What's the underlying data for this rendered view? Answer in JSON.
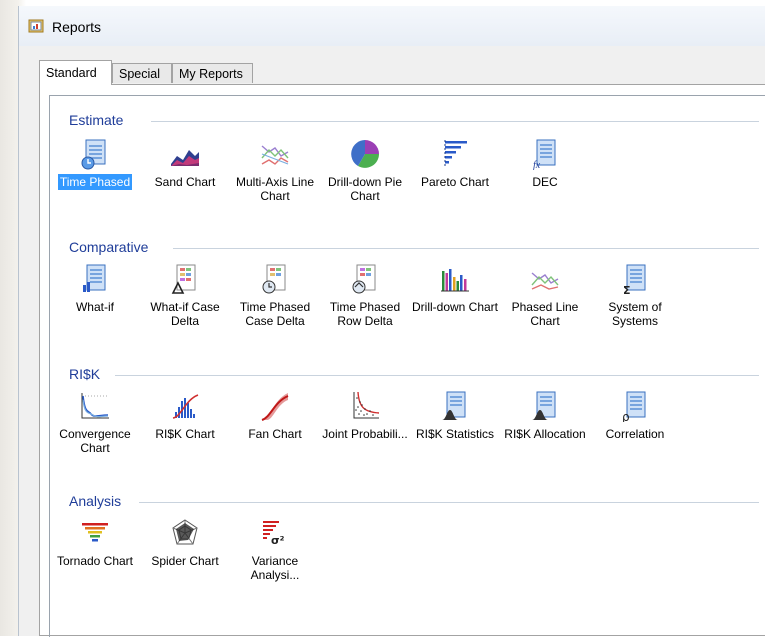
{
  "window": {
    "title": "Reports"
  },
  "tabs": [
    {
      "label": "Standard",
      "active": true
    },
    {
      "label": "Special",
      "active": false
    },
    {
      "label": "My Reports",
      "active": false
    }
  ],
  "sections": {
    "estimate": {
      "title": "Estimate",
      "items": [
        {
          "label": "Time Phased",
          "icon": "document-clock-icon",
          "selected": true
        },
        {
          "label": "Sand Chart",
          "icon": "sand-chart-icon"
        },
        {
          "label": "Multi-Axis Line Chart",
          "icon": "multi-line-chart-icon"
        },
        {
          "label": "Drill-down Pie Chart",
          "icon": "pie-chart-icon"
        },
        {
          "label": "Pareto Chart",
          "icon": "pareto-chart-icon"
        },
        {
          "label": "DEC",
          "icon": "document-formula-icon"
        }
      ]
    },
    "comparative": {
      "title": "Comparative",
      "items": [
        {
          "label": "What-if",
          "icon": "document-chart-icon"
        },
        {
          "label": "What-if Case Delta",
          "icon": "document-delta-icon"
        },
        {
          "label": "Time Phased Case Delta",
          "icon": "document-clock-delta-icon"
        },
        {
          "label": "Time Phased Row Delta",
          "icon": "document-clock-row-icon"
        },
        {
          "label": "Drill-down Chart",
          "icon": "bar-chart-icon"
        },
        {
          "label": "Phased Line Chart",
          "icon": "line-chart-icon"
        },
        {
          "label": "System of Systems",
          "icon": "document-sigma-icon"
        }
      ]
    },
    "risk": {
      "title": "RI$K",
      "items": [
        {
          "label": "Convergence Chart",
          "icon": "convergence-chart-icon"
        },
        {
          "label": "RI$K Chart",
          "icon": "histogram-icon"
        },
        {
          "label": "Fan Chart",
          "icon": "fan-chart-icon"
        },
        {
          "label": "Joint Probabili...",
          "icon": "scatter-plot-icon"
        },
        {
          "label": "RI$K Statistics",
          "icon": "document-bell-curve-icon"
        },
        {
          "label": "RI$K Allocation",
          "icon": "document-bell-curve-icon"
        },
        {
          "label": "Correlation",
          "icon": "document-rho-icon"
        }
      ]
    },
    "analysis": {
      "title": "Analysis",
      "items": [
        {
          "label": "Tornado Chart",
          "icon": "tornado-chart-icon"
        },
        {
          "label": "Spider Chart",
          "icon": "spider-chart-icon"
        },
        {
          "label": "Variance Analysi...",
          "icon": "variance-icon"
        }
      ]
    }
  }
}
